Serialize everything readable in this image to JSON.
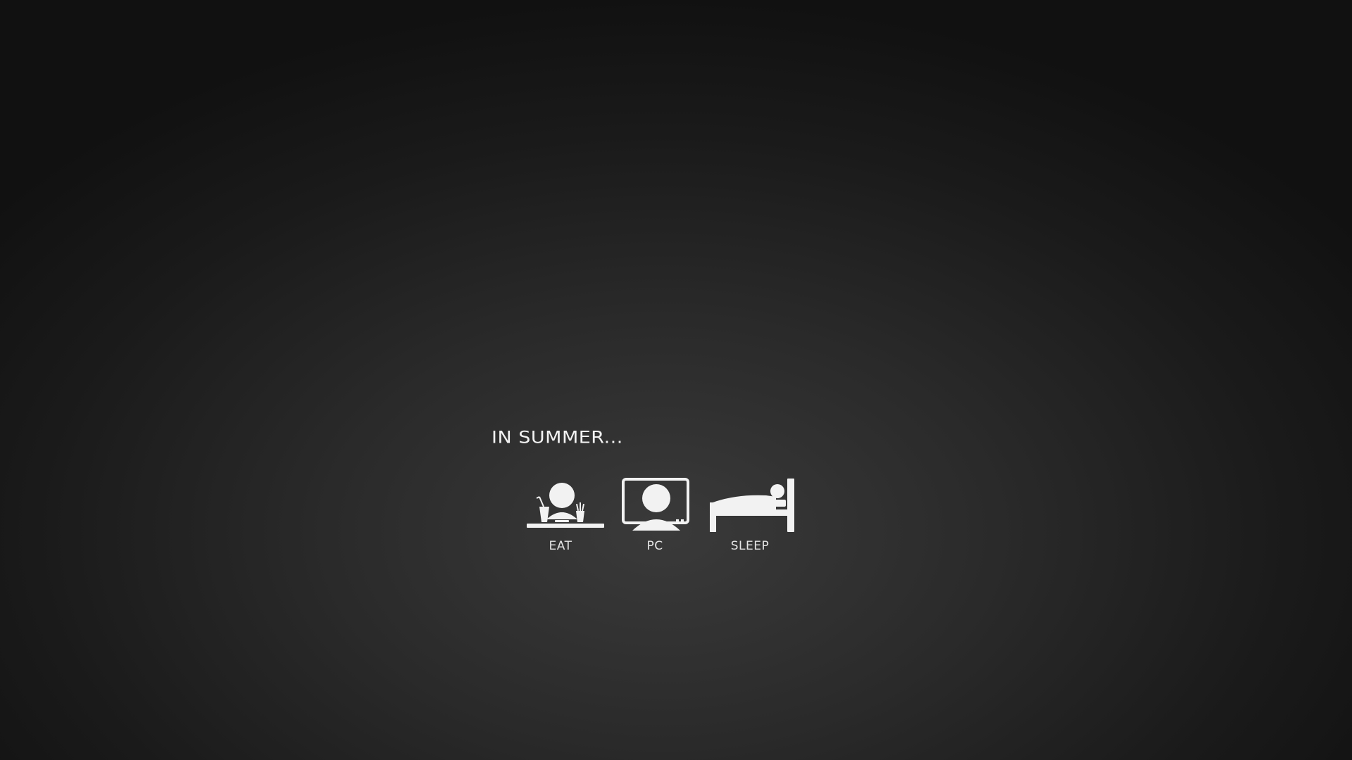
{
  "headline": "IN SUMMER...",
  "activities": [
    {
      "label": "EAT",
      "icon": "person-eating-icon"
    },
    {
      "label": "PC",
      "icon": "person-at-computer-icon"
    },
    {
      "label": "SLEEP",
      "icon": "person-sleeping-in-bed-icon"
    }
  ],
  "colors": {
    "background_center": "#3a3a3a",
    "background_edge": "#111111",
    "foreground": "#f2f2f2"
  }
}
